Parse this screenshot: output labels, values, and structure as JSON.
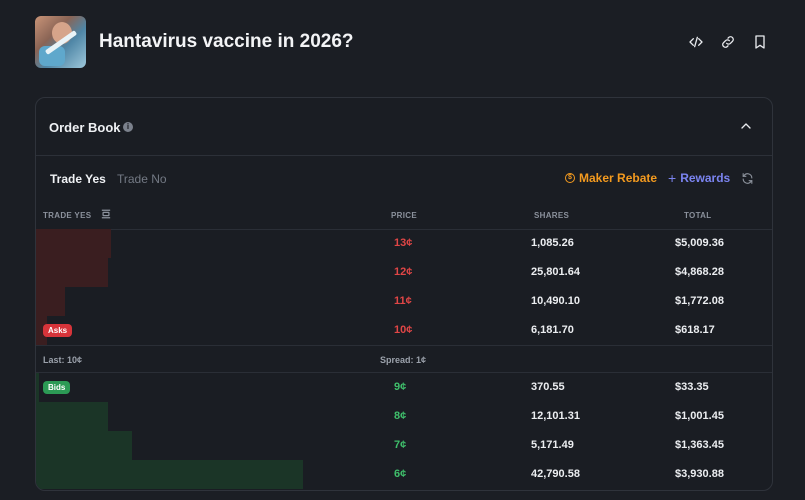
{
  "market": {
    "title": "Hantavirus vaccine in 2026?"
  },
  "header_icons": [
    "embed-code-icon",
    "link-icon",
    "bookmark-icon"
  ],
  "order_book": {
    "title": "Order Book",
    "tabs": {
      "yes": "Trade Yes",
      "no": "Trade No"
    },
    "maker_rebate": "Maker Rebate",
    "rewards": "Rewards",
    "columns": {
      "trade": "TRADE YES",
      "price": "PRICE",
      "shares": "SHARES",
      "total": "TOTAL"
    },
    "asks_label": "Asks",
    "bids_label": "Bids",
    "asks": [
      {
        "price": "13¢",
        "shares": "1,085.26",
        "total": "$5,009.36",
        "depth_fraction": 0.28
      },
      {
        "price": "12¢",
        "shares": "25,801.64",
        "total": "$4,868.28",
        "depth_fraction": 0.27
      },
      {
        "price": "11¢",
        "shares": "10,490.10",
        "total": "$1,772.08",
        "depth_fraction": 0.11
      },
      {
        "price": "10¢",
        "shares": "6,181.70",
        "total": "$618.17",
        "depth_fraction": 0.04
      }
    ],
    "last": "Last: 10¢",
    "spread": "Spread: 1¢",
    "bids": [
      {
        "price": "9¢",
        "shares": "370.55",
        "total": "$33.35",
        "depth_fraction": 0.01
      },
      {
        "price": "8¢",
        "shares": "12,101.31",
        "total": "$1,001.45",
        "depth_fraction": 0.27
      },
      {
        "price": "7¢",
        "shares": "5,171.49",
        "total": "$1,363.45",
        "depth_fraction": 0.36
      },
      {
        "price": "6¢",
        "shares": "42,790.58",
        "total": "$3,930.88",
        "depth_fraction": 1.0
      }
    ]
  },
  "colors": {
    "ask": "#e04646",
    "bid": "#3fbf6b",
    "maker_rebate": "#f39a1f",
    "rewards": "#7b84f0"
  }
}
